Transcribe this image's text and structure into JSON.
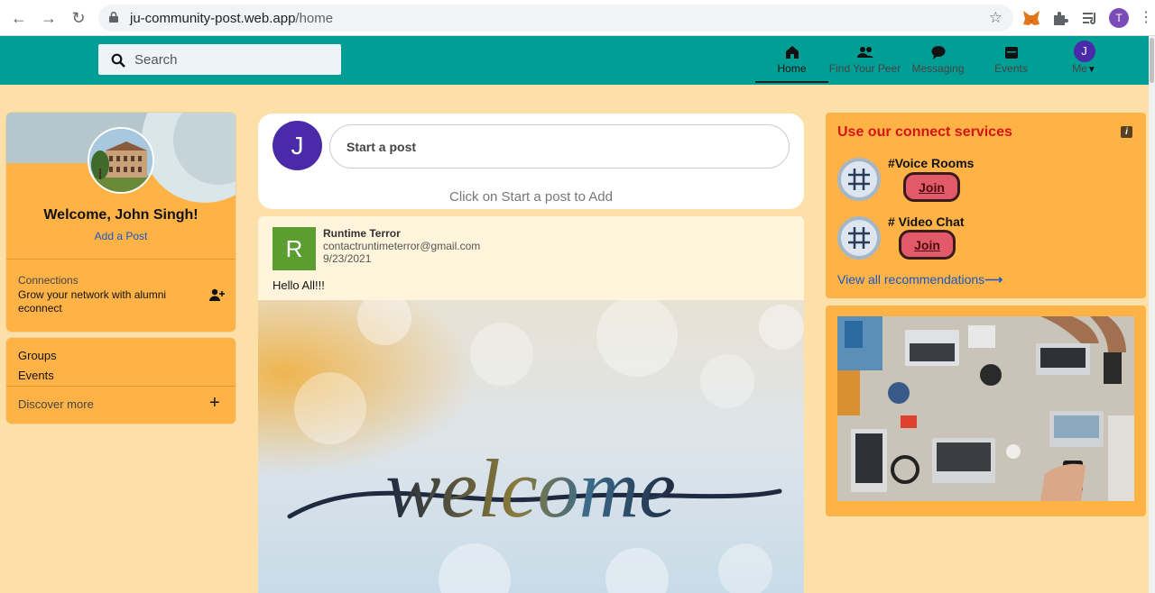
{
  "browser": {
    "url_host": "ju-community-post.web.app",
    "url_path": "/home",
    "profile_initial": "T"
  },
  "header": {
    "search_placeholder": "Search",
    "nav": [
      {
        "label": "Home",
        "icon": "home-icon",
        "active": true
      },
      {
        "label": "Find Your Peer",
        "icon": "people-icon"
      },
      {
        "label": "Messaging",
        "icon": "chat-icon"
      },
      {
        "label": "Events",
        "icon": "calendar-icon"
      },
      {
        "label": "Me",
        "icon": "avatar",
        "initial": "J"
      }
    ]
  },
  "profile": {
    "welcome": "Welcome, John Singh!",
    "add_post": "Add a Post",
    "connections_title": "Connections",
    "connections_desc": "Grow your network with alumni econnect"
  },
  "groups": {
    "groups_label": "Groups",
    "events_label": "Events",
    "discover_label": "Discover more"
  },
  "composer": {
    "avatar_initial": "J",
    "start_label": "Start a post",
    "hint": "Click on Start a post to Add"
  },
  "post": {
    "avatar_initial": "R",
    "author": "Runtime Terror",
    "email": "contactruntimeterror@gmail.com",
    "date": "9/23/2021",
    "text": "Hello All!!!",
    "image_word": "welcome"
  },
  "connect": {
    "title": "Use our connect services",
    "rooms": [
      {
        "name": "#Voice Rooms",
        "join_label": "Join"
      },
      {
        "name": "# Video Chat",
        "join_label": "Join"
      }
    ],
    "view_all": "View all recommendations"
  },
  "colors": {
    "appbar": "#009e94",
    "page_bg": "#fde0a8",
    "card": "#ffb347",
    "accent_purple": "#4a2aa8",
    "title_red": "#d41515"
  }
}
